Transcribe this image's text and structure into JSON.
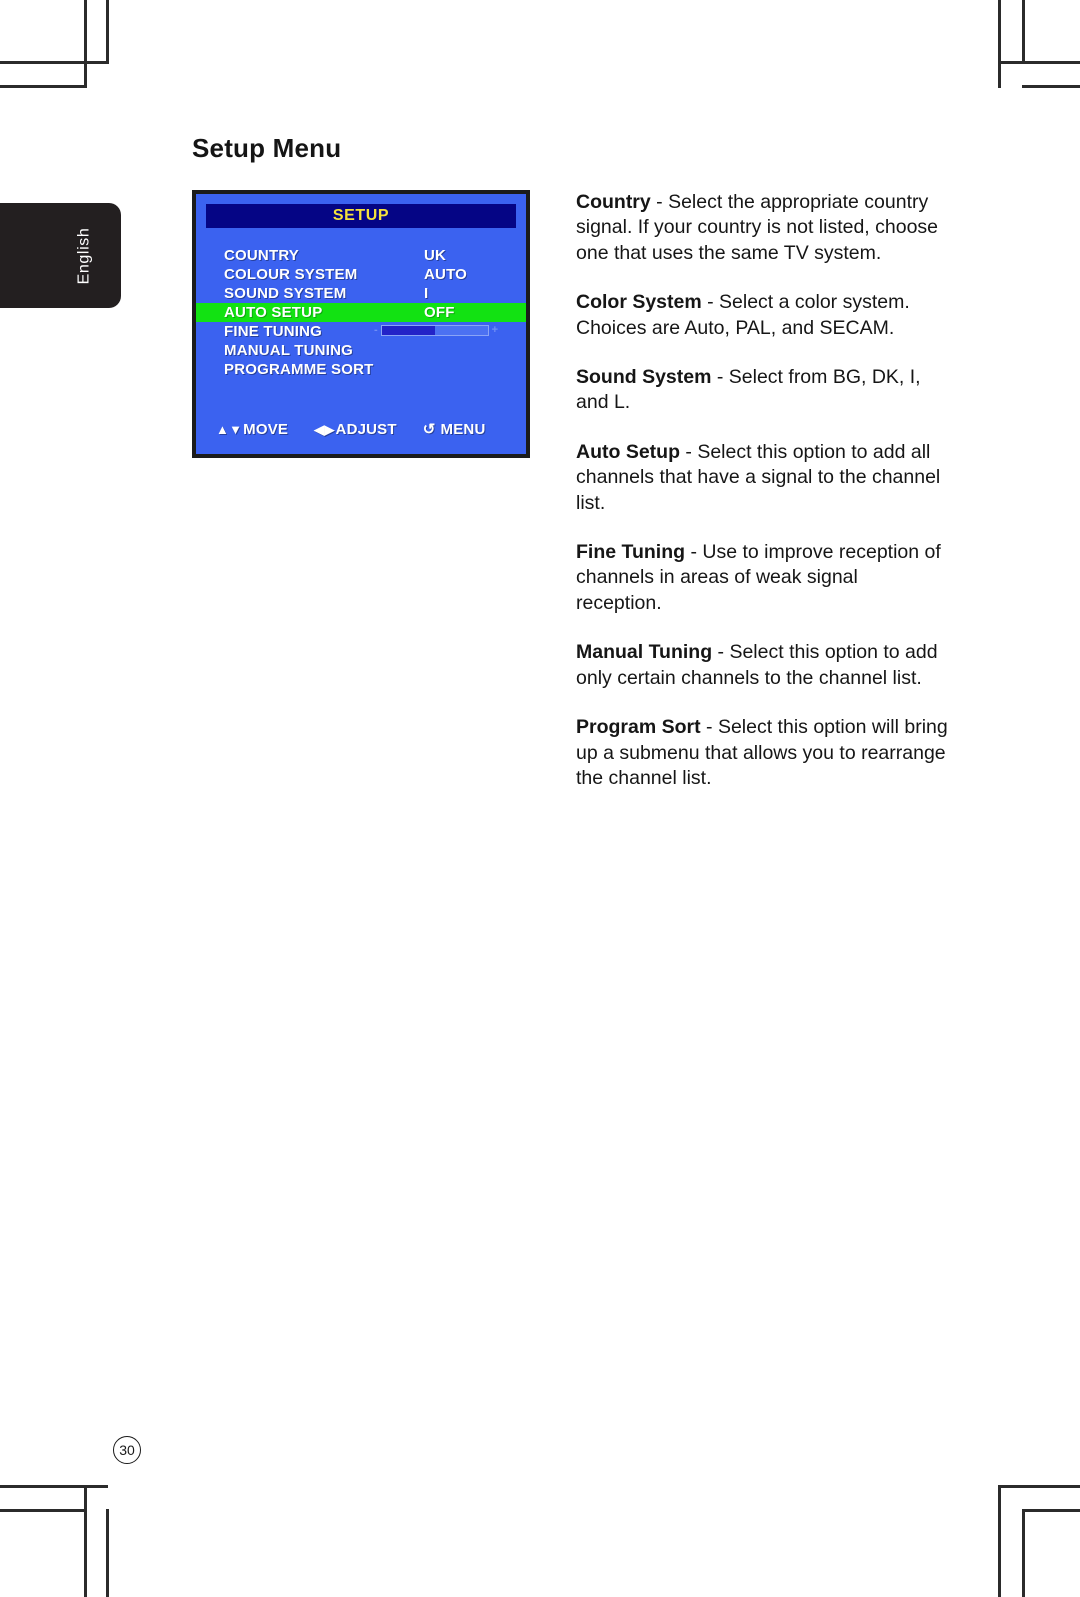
{
  "page": {
    "heading": "Setup Menu",
    "language_tab": "English",
    "page_number": "30"
  },
  "osd": {
    "title": "SETUP",
    "rows": [
      {
        "label": "COUNTRY",
        "value": "UK",
        "highlighted": false,
        "slider": false
      },
      {
        "label": "COLOUR SYSTEM",
        "value": "AUTO",
        "highlighted": false,
        "slider": false
      },
      {
        "label": "SOUND SYSTEM",
        "value": "I",
        "highlighted": false,
        "slider": false
      },
      {
        "label": "AUTO SETUP",
        "value": "OFF",
        "highlighted": true,
        "slider": false
      },
      {
        "label": "FINE TUNING",
        "value": "",
        "highlighted": false,
        "slider": true
      },
      {
        "label": "MANUAL TUNING",
        "value": "",
        "highlighted": false,
        "slider": false
      },
      {
        "label": "PROGRAMME SORT",
        "value": "",
        "highlighted": false,
        "slider": false
      }
    ],
    "slider": {
      "minus_label": "-",
      "plus_label": "+",
      "fill_percent": 50
    },
    "footer": [
      {
        "glyph": "▲▼",
        "label": "MOVE"
      },
      {
        "glyph": "◀▶",
        "label": "ADJUST"
      },
      {
        "glyph": "↺",
        "label": "MENU"
      }
    ],
    "colors": {
      "background": "#3b62f0",
      "title_bar": "#050585",
      "title_text": "#f5e23c",
      "highlight": "#12e212",
      "text": "#ffffff",
      "border": "#1b1b1b",
      "slider_fill": "#2323c8"
    }
  },
  "descriptions": [
    {
      "term": "Country",
      "text": " - Select the appropriate country signal. If your country is not listed, choose one that uses the same TV system."
    },
    {
      "term": "Color System",
      "text": " - Select a color system. Choices are Auto, PAL, and SECAM."
    },
    {
      "term": "Sound System",
      "text": " - Select from BG, DK, I, and L."
    },
    {
      "term": "Auto Setup",
      "text": " - Select this option to add all channels that have a signal to the channel list."
    },
    {
      "term": "Fine Tuning",
      "text": " - Use to improve reception of channels in areas of weak signal reception."
    },
    {
      "term": "Manual Tuning",
      "text": " - Select this option to add only certain channels to the channel list."
    },
    {
      "term": "Program Sort",
      "text": " - Select this option will bring up a submenu that allows you to rearrange the channel list."
    }
  ]
}
